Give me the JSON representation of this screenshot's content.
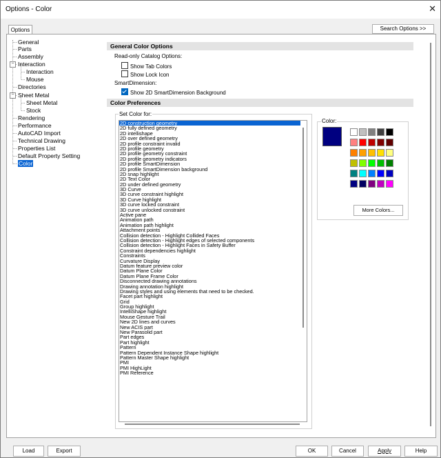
{
  "window": {
    "title": "Options - Color",
    "close": "✕"
  },
  "tab": "Options",
  "search_button": "Search Options >>",
  "tree": {
    "items": [
      "General",
      "Parts",
      "Assembly",
      "Interaction",
      "Interaction",
      "Mouse",
      "Directories",
      "Sheet Metal",
      "Sheet Metal",
      "Stock",
      "Rendering",
      "Performance",
      "AutoCAD Import",
      "Technical Drawing",
      "Properties List",
      "Default Property Setting",
      "Color"
    ]
  },
  "general": {
    "header": "General Color Options",
    "readonly_label": "Read-only Catalog Options:",
    "show_tab_colors": "Show Tab Colors",
    "show_lock_icon": "Show Lock Icon",
    "smartdim_label": "SmartDimension:",
    "show_2d_smartdim": "Show 2D SmartDimension Background"
  },
  "prefs": {
    "header": "Color Preferences",
    "set_color_for": "Set Color for:",
    "items": [
      "2D construction geometry",
      "2D fully defined geometry",
      "2D intellishape",
      "2D over defined geometry",
      "2D profile constraint invalid",
      "2D profile geometry",
      "2D profile geometry constraint",
      "2D profile geometry indicators",
      "2D profile SmartDimension",
      "2D profile SmartDimension background",
      "2D snap highlight",
      "2D Text Color",
      "2D under defined geometry",
      "3D Curve",
      "3D curve constraint highlight",
      "3D Curve highlight",
      "3D curve locked constraint",
      "3D curve unlocked constraint",
      "Active pane",
      "Animation path",
      "Animation path highlight",
      "Attachment points",
      "Collision detection - Highlight Collided Faces",
      "Collision detection - Highlight edges of selected components",
      "Collision detection - Highlight Faces in Safety Buffer",
      "Constraint dependencies highlight",
      "Constraints",
      "Curvature Display",
      "Datum feature preview color",
      "Datum Plane Color",
      "Datum Plane Frame Color",
      "Disconnected drawing annotations",
      "Drawing annotation highlight",
      "Drawing styles and using elements that need to be checked.",
      "Facet part highlight",
      "Grid",
      "Group highlight",
      "IntelliShape highlight",
      "Mouse Gesture Trail",
      "New 2D lines and curves",
      "New ACIS part",
      "New Parasolid part",
      "Part edges",
      "Part highlight",
      "Pattern",
      "Pattern Dependent Instance Shape highlight",
      "Pattern Master Shape highlight",
      "PMI",
      "PMI HighLight",
      "PMI Reference"
    ]
  },
  "color_panel": {
    "label": "Color:",
    "current": "#000080",
    "palette": [
      "#ffffff",
      "#c0c0c0",
      "#808080",
      "#404040",
      "#000000",
      "#ff8080",
      "#ff0000",
      "#c00000",
      "#800000",
      "#600000",
      "#ff8000",
      "#ffa000",
      "#ffc000",
      "#ffe000",
      "#ffff80",
      "#c0c000",
      "#80ff00",
      "#00ff00",
      "#00c000",
      "#008000",
      "#008080",
      "#00ffff",
      "#0080ff",
      "#0000ff",
      "#0000c0",
      "#000080",
      "#000060",
      "#800080",
      "#c000c0",
      "#ff00ff"
    ],
    "more_colors": "More Colors..."
  },
  "buttons": {
    "load": "Load",
    "export": "Export",
    "ok": "OK",
    "cancel": "Cancel",
    "apply": "Apply",
    "help": "Help"
  }
}
